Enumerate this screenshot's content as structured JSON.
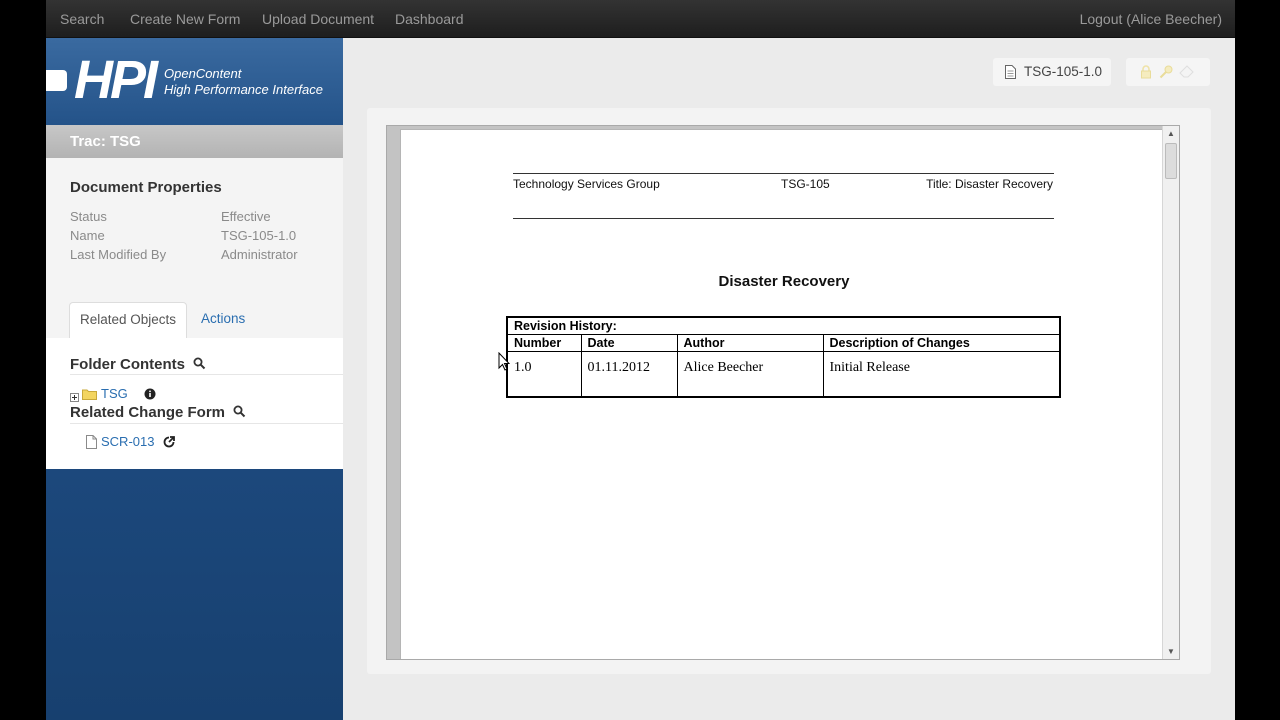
{
  "nav": {
    "search": "Search",
    "create_form": "Create New Form",
    "upload": "Upload Document",
    "dashboard": "Dashboard",
    "logout": "Logout (Alice Beecher)"
  },
  "logo": {
    "main": "HPI",
    "line1": "OpenContent",
    "line2": "High Performance Interface"
  },
  "trac": "Trac: TSG",
  "props": {
    "title": "Document Properties",
    "rows": [
      {
        "label": "Status",
        "value": "Effective"
      },
      {
        "label": "Name",
        "value": "TSG-105-1.0"
      },
      {
        "label": "Last Modified By",
        "value": "Administrator"
      }
    ]
  },
  "tabs": {
    "related": "Related Objects",
    "actions": "Actions"
  },
  "related": {
    "folder_title": "Folder Contents",
    "folder_item": "TSG",
    "change_title": "Related Change Form",
    "change_item": "SCR-013"
  },
  "doc_chip": "TSG-105-1.0",
  "document": {
    "header_left": "Technology Services Group",
    "header_mid": "TSG-105",
    "header_right": "Title: Disaster Recovery",
    "title": "Disaster Recovery",
    "table": {
      "caption": "Revision History:",
      "columns": [
        "Number",
        "Date",
        "Author",
        "Description of Changes"
      ],
      "rows": [
        [
          "1.0",
          "01.11.2012",
          "Alice Beecher",
          "Initial Release"
        ]
      ]
    }
  },
  "icons": {
    "folder_plus": "plus-box-icon",
    "folder": "folder-icon",
    "info": "info-icon",
    "search": "magnifier-icon",
    "document": "document-icon",
    "external": "external-link-icon"
  },
  "colors": {
    "nav_bg": "#262626",
    "sidebar": "#1f4d84",
    "link": "#2a6eb0"
  }
}
